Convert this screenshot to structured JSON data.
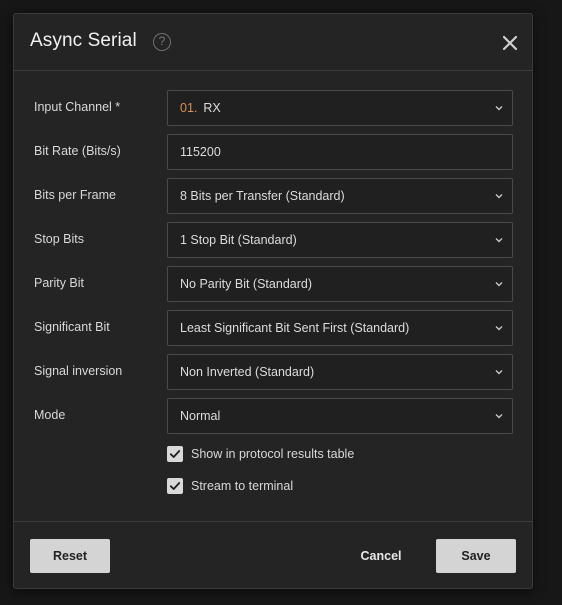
{
  "dialog": {
    "title": "Async Serial",
    "help_glyph": "?"
  },
  "fields": [
    {
      "label": "Input Channel *",
      "channel_num": "01.",
      "value": "RX",
      "type": "select"
    },
    {
      "label": "Bit Rate (Bits/s)",
      "value": "115200",
      "type": "input"
    },
    {
      "label": "Bits per Frame",
      "value": "8 Bits per Transfer (Standard)",
      "type": "select"
    },
    {
      "label": "Stop Bits",
      "value": "1 Stop Bit (Standard)",
      "type": "select"
    },
    {
      "label": "Parity Bit",
      "value": "No Parity Bit (Standard)",
      "type": "select"
    },
    {
      "label": "Significant Bit",
      "value": "Least Significant Bit Sent First (Standard)",
      "type": "select"
    },
    {
      "label": "Signal inversion",
      "value": "Non Inverted (Standard)",
      "type": "select"
    },
    {
      "label": "Mode",
      "value": "Normal",
      "type": "select"
    }
  ],
  "checkboxes": [
    {
      "label": "Show in protocol results table",
      "checked": true
    },
    {
      "label": "Stream to terminal",
      "checked": true
    }
  ],
  "footer": {
    "reset_label": "Reset",
    "cancel_label": "Cancel",
    "save_label": "Save"
  },
  "colors": {
    "background": "#242424",
    "channel_number": "#d9915a",
    "button": "#d4d4d4"
  }
}
